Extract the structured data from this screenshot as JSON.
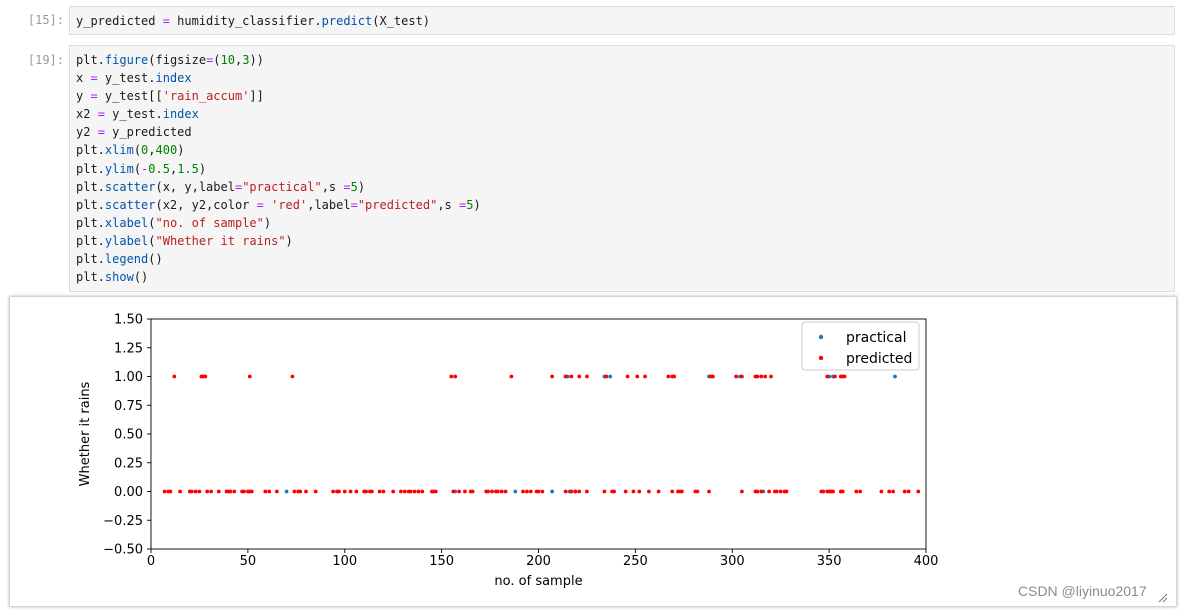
{
  "cells": [
    {
      "prompt": "[15]:",
      "lines": [
        [
          [
            "y_predicted ",
            ""
          ],
          [
            "=",
            "eq"
          ],
          [
            " humidity_classifier.",
            ""
          ],
          [
            "predict",
            "fn"
          ],
          [
            "(X_test)",
            ""
          ]
        ]
      ]
    },
    {
      "prompt": "[19]:",
      "lines": [
        [
          [
            "plt.",
            ""
          ],
          [
            "figure",
            "fn"
          ],
          [
            "(figsize",
            ""
          ],
          [
            "=",
            "eq"
          ],
          [
            "(",
            ""
          ],
          [
            "10",
            "num"
          ],
          [
            ",",
            ""
          ],
          [
            "3",
            "num"
          ],
          [
            "))",
            ""
          ]
        ],
        [
          [
            "x ",
            ""
          ],
          [
            "=",
            "eq"
          ],
          [
            " y_test.",
            ""
          ],
          [
            "index",
            "fn"
          ]
        ],
        [
          [
            "y ",
            ""
          ],
          [
            "=",
            "eq"
          ],
          [
            " y_test[[",
            ""
          ],
          [
            "'rain_accum'",
            "str"
          ],
          [
            "]]",
            ""
          ]
        ],
        [
          [
            "x2 ",
            ""
          ],
          [
            "=",
            "eq"
          ],
          [
            " y_test.",
            ""
          ],
          [
            "index",
            "fn"
          ]
        ],
        [
          [
            "y2 ",
            ""
          ],
          [
            "=",
            "eq"
          ],
          [
            " y_predicted",
            ""
          ]
        ],
        [
          [
            "plt.",
            ""
          ],
          [
            "xlim",
            "fn"
          ],
          [
            "(",
            ""
          ],
          [
            "0",
            "num"
          ],
          [
            ",",
            ""
          ],
          [
            "400",
            "num"
          ],
          [
            ")",
            ""
          ]
        ],
        [
          [
            "plt.",
            ""
          ],
          [
            "ylim",
            "fn"
          ],
          [
            "(",
            ""
          ],
          [
            "-",
            "eq"
          ],
          [
            "0.5",
            "num"
          ],
          [
            ",",
            ""
          ],
          [
            "1.5",
            "num"
          ],
          [
            ")",
            ""
          ]
        ],
        [
          [
            "plt.",
            ""
          ],
          [
            "scatter",
            "fn"
          ],
          [
            "(x, y,label",
            ""
          ],
          [
            "=",
            "eq"
          ],
          [
            "\"practical\"",
            "str"
          ],
          [
            ",s ",
            ""
          ],
          [
            "=",
            "eq"
          ],
          [
            "5",
            "num"
          ],
          [
            ")",
            ""
          ]
        ],
        [
          [
            "plt.",
            ""
          ],
          [
            "scatter",
            "fn"
          ],
          [
            "(x2, y2,color ",
            ""
          ],
          [
            "=",
            "eq"
          ],
          [
            " ",
            ""
          ],
          [
            "'red'",
            "str"
          ],
          [
            ",label",
            ""
          ],
          [
            "=",
            "eq"
          ],
          [
            "\"predicted\"",
            "str"
          ],
          [
            ",s ",
            ""
          ],
          [
            "=",
            "eq"
          ],
          [
            "5",
            "num"
          ],
          [
            ")",
            ""
          ]
        ],
        [
          [
            "plt.",
            ""
          ],
          [
            "xlabel",
            "fn"
          ],
          [
            "(",
            ""
          ],
          [
            "\"no. of sample\"",
            "str"
          ],
          [
            ")",
            ""
          ]
        ],
        [
          [
            "plt.",
            ""
          ],
          [
            "ylabel",
            "fn"
          ],
          [
            "(",
            ""
          ],
          [
            "\"Whether it rains\"",
            "str"
          ],
          [
            ")",
            ""
          ]
        ],
        [
          [
            "plt.",
            ""
          ],
          [
            "legend",
            "fn"
          ],
          [
            "()",
            ""
          ]
        ],
        [
          [
            "plt.",
            ""
          ],
          [
            "show",
            "fn"
          ],
          [
            "()",
            ""
          ]
        ]
      ]
    }
  ],
  "chart_data": {
    "type": "scatter",
    "title": "",
    "xlabel": "no. of sample",
    "ylabel": "Whether it rains",
    "xlim": [
      0,
      400
    ],
    "ylim": [
      -0.5,
      1.5
    ],
    "xticks": [
      0,
      50,
      100,
      150,
      200,
      250,
      300,
      350,
      400
    ],
    "yticks": [
      -0.5,
      -0.25,
      0,
      0.25,
      0.5,
      0.75,
      1,
      1.25,
      1.5
    ],
    "xtick_labels": [
      "0",
      "50",
      "100",
      "150",
      "200",
      "250",
      "300",
      "350",
      "400"
    ],
    "ytick_labels": [
      "−0.50",
      "−0.25",
      "0.00",
      "0.25",
      "0.50",
      "0.75",
      "1.00",
      "1.25",
      "1.50"
    ],
    "grid": false,
    "legend_position": "top-right",
    "series": [
      {
        "name": "practical",
        "color": "#1f77b4",
        "points": [
          [
            70,
            0
          ],
          [
            157,
            0
          ],
          [
            188,
            0
          ],
          [
            207,
            0
          ],
          [
            216,
            0
          ],
          [
            219,
            0
          ],
          [
            316,
            0
          ],
          [
            215,
            1
          ],
          [
            234,
            1
          ],
          [
            237,
            1
          ],
          [
            288,
            1
          ],
          [
            304,
            1
          ],
          [
            350,
            1
          ],
          [
            352,
            1
          ],
          [
            384,
            1
          ]
        ]
      },
      {
        "name": "predicted",
        "color": "#ff0000",
        "points": [
          [
            12,
            1
          ],
          [
            26,
            1
          ],
          [
            27,
            1
          ],
          [
            28,
            1
          ],
          [
            51,
            1
          ],
          [
            73,
            1
          ],
          [
            155,
            1
          ],
          [
            157,
            1
          ],
          [
            186,
            1
          ],
          [
            207,
            1
          ],
          [
            214,
            1
          ],
          [
            217,
            1
          ],
          [
            221,
            1
          ],
          [
            225,
            1
          ],
          [
            235,
            1
          ],
          [
            246,
            1
          ],
          [
            251,
            1
          ],
          [
            255,
            1
          ],
          [
            267,
            1
          ],
          [
            269,
            1
          ],
          [
            270,
            1
          ],
          [
            289,
            1
          ],
          [
            290,
            1
          ],
          [
            302,
            1
          ],
          [
            305,
            1
          ],
          [
            312,
            1
          ],
          [
            313,
            1
          ],
          [
            315,
            1
          ],
          [
            317,
            1
          ],
          [
            320,
            1
          ],
          [
            349,
            1
          ],
          [
            353,
            1
          ],
          [
            356,
            1
          ],
          [
            357,
            1
          ],
          [
            358,
            1
          ],
          [
            7,
            0
          ],
          [
            9,
            0
          ],
          [
            10,
            0
          ],
          [
            15,
            0
          ],
          [
            20,
            0
          ],
          [
            21,
            0
          ],
          [
            23,
            0
          ],
          [
            25,
            0
          ],
          [
            29,
            0
          ],
          [
            31,
            0
          ],
          [
            35,
            0
          ],
          [
            39,
            0
          ],
          [
            40,
            0
          ],
          [
            41,
            0
          ],
          [
            43,
            0
          ],
          [
            47,
            0
          ],
          [
            48,
            0
          ],
          [
            50,
            0
          ],
          [
            51,
            0
          ],
          [
            52,
            0
          ],
          [
            59,
            0
          ],
          [
            61,
            0
          ],
          [
            65,
            0
          ],
          [
            74,
            0
          ],
          [
            76,
            0
          ],
          [
            77,
            0
          ],
          [
            80,
            0
          ],
          [
            85,
            0
          ],
          [
            94,
            0
          ],
          [
            96,
            0
          ],
          [
            97,
            0
          ],
          [
            100,
            0
          ],
          [
            103,
            0
          ],
          [
            106,
            0
          ],
          [
            110,
            0
          ],
          [
            111,
            0
          ],
          [
            113,
            0
          ],
          [
            114,
            0
          ],
          [
            118,
            0
          ],
          [
            120,
            0
          ],
          [
            125,
            0
          ],
          [
            129,
            0
          ],
          [
            131,
            0
          ],
          [
            133,
            0
          ],
          [
            134,
            0
          ],
          [
            136,
            0
          ],
          [
            138,
            0
          ],
          [
            140,
            0
          ],
          [
            145,
            0
          ],
          [
            146,
            0
          ],
          [
            147,
            0
          ],
          [
            156,
            0
          ],
          [
            159,
            0
          ],
          [
            162,
            0
          ],
          [
            165,
            0
          ],
          [
            166,
            0
          ],
          [
            173,
            0
          ],
          [
            174,
            0
          ],
          [
            176,
            0
          ],
          [
            178,
            0
          ],
          [
            179,
            0
          ],
          [
            181,
            0
          ],
          [
            183,
            0
          ],
          [
            192,
            0
          ],
          [
            194,
            0
          ],
          [
            196,
            0
          ],
          [
            199,
            0
          ],
          [
            200,
            0
          ],
          [
            202,
            0
          ],
          [
            214,
            0
          ],
          [
            217,
            0
          ],
          [
            219,
            0
          ],
          [
            221,
            0
          ],
          [
            225,
            0
          ],
          [
            234,
            0
          ],
          [
            238,
            0
          ],
          [
            239,
            0
          ],
          [
            245,
            0
          ],
          [
            249,
            0
          ],
          [
            252,
            0
          ],
          [
            257,
            0
          ],
          [
            262,
            0
          ],
          [
            269,
            0
          ],
          [
            272,
            0
          ],
          [
            273,
            0
          ],
          [
            274,
            0
          ],
          [
            281,
            0
          ],
          [
            282,
            0
          ],
          [
            288,
            0
          ],
          [
            305,
            0
          ],
          [
            312,
            0
          ],
          [
            313,
            0
          ],
          [
            315,
            0
          ],
          [
            319,
            0
          ],
          [
            322,
            0
          ],
          [
            323,
            0
          ],
          [
            325,
            0
          ],
          [
            327,
            0
          ],
          [
            328,
            0
          ],
          [
            346,
            0
          ],
          [
            347,
            0
          ],
          [
            349,
            0
          ],
          [
            350,
            0
          ],
          [
            351,
            0
          ],
          [
            352,
            0
          ],
          [
            356,
            0
          ],
          [
            357,
            0
          ],
          [
            364,
            0
          ],
          [
            366,
            0
          ],
          [
            377,
            0
          ],
          [
            381,
            0
          ],
          [
            383,
            0
          ],
          [
            389,
            0
          ],
          [
            391,
            0
          ],
          [
            396,
            0
          ]
        ]
      }
    ]
  },
  "watermark": "CSDN @liyinuo2017"
}
